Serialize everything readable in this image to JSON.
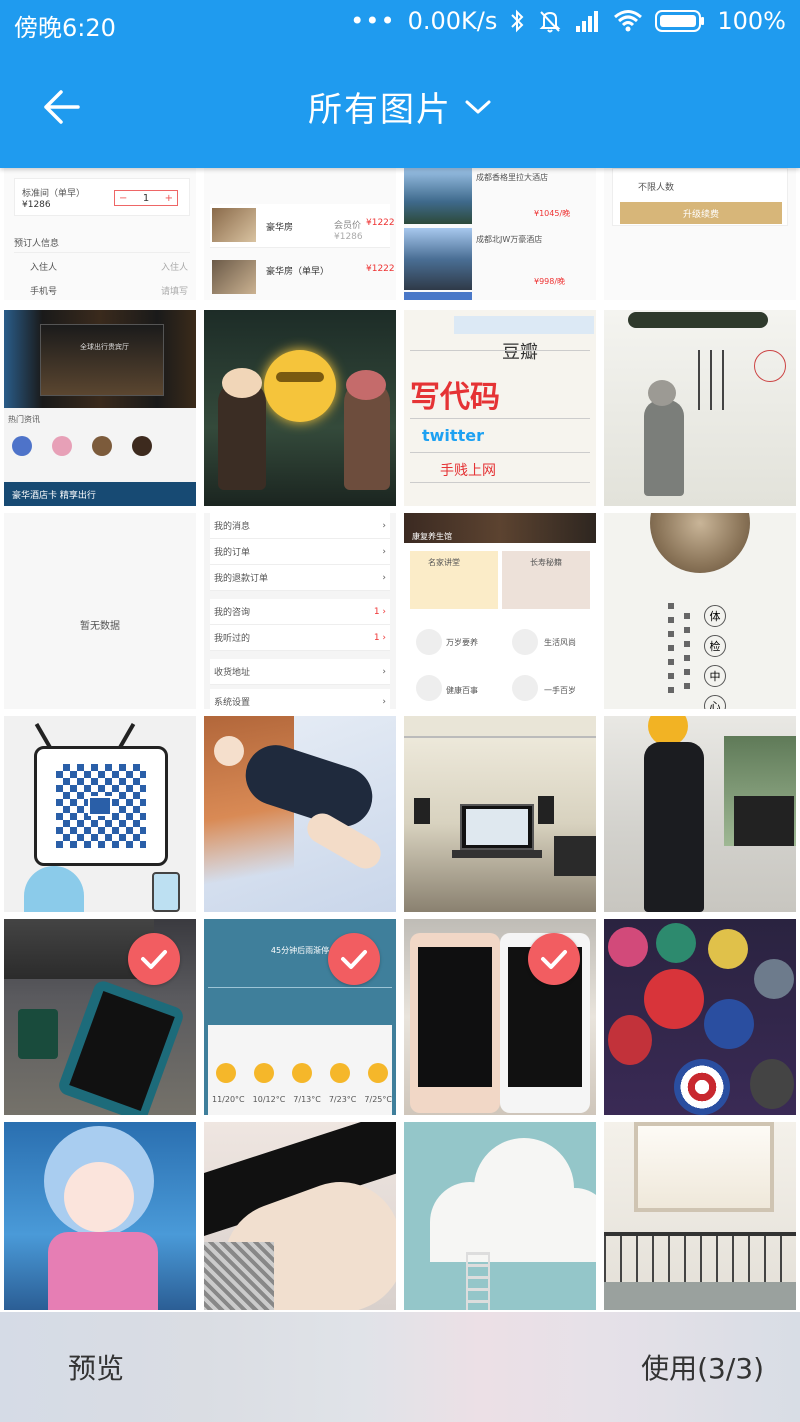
{
  "status_bar": {
    "time": "傍晚6:20",
    "dots": "•••",
    "speed": "0.00K/s",
    "battery": "100%"
  },
  "toolbar": {
    "title": "所有图片"
  },
  "grid": {
    "selected": [
      16,
      17,
      18
    ],
    "tiles": [
      {
        "id": 0,
        "kind": "screenshot-hotel-booking",
        "text": [
          "标准间（单早）",
          "¥1286",
          "预订人信息",
          "入住人",
          "入住人",
          "手机号",
          "请填写"
        ]
      },
      {
        "id": 1,
        "kind": "screenshot-hotel-list",
        "text": [
          "豪华房",
          "会员价",
          "¥1222",
          "¥1286",
          "豪华房（单早）",
          "¥1222"
        ]
      },
      {
        "id": 2,
        "kind": "screenshot-hotel-rooms",
        "text": [
          "成都香格里拉大酒店",
          "¥1045/晚",
          "成都北JW万豪酒店",
          "¥998/晚"
        ]
      },
      {
        "id": 3,
        "kind": "screenshot-form",
        "text": [
          "不限人数",
          "升级续费"
        ]
      },
      {
        "id": 4,
        "kind": "screenshot-hotel-home",
        "text": [
          "热门资讯",
          "全球出行贵宾厅",
          "豪华酒店卡 精享出行"
        ]
      },
      {
        "id": 5,
        "kind": "anime-forest"
      },
      {
        "id": 6,
        "kind": "poster-text",
        "text": [
          "写代码",
          "twitter",
          "豆瓣",
          "手贱上网"
        ]
      },
      {
        "id": 7,
        "kind": "ink-painting"
      },
      {
        "id": 8,
        "kind": "empty-state",
        "text": [
          "暂无数据"
        ]
      },
      {
        "id": 9,
        "kind": "screenshot-menu",
        "text": [
          "我的消息",
          "我的订单",
          "我的退款订单",
          "我的咨询",
          "我听过的",
          "收货地址",
          "系统设置"
        ]
      },
      {
        "id": 10,
        "kind": "screenshot-health",
        "text": [
          "康复养生馆",
          "名家讲堂",
          "长寿秘籍",
          "万岁要养",
          "生活风尚",
          "健康百事",
          "一手百岁"
        ]
      },
      {
        "id": 11,
        "kind": "ink-circle",
        "text": [
          "体",
          "检",
          "中",
          "心"
        ]
      },
      {
        "id": 12,
        "kind": "qr-tv"
      },
      {
        "id": 13,
        "kind": "anime-girl-lying"
      },
      {
        "id": 14,
        "kind": "office-laptop"
      },
      {
        "id": 15,
        "kind": "person-lobby"
      },
      {
        "id": 16,
        "kind": "phone-teal-desk"
      },
      {
        "id": 17,
        "kind": "screenshot-weather",
        "text": [
          "45分钟后雨渐停",
          "11/20°C",
          "10/12°C",
          "7/13°C",
          "7/23°C",
          "7/25°C"
        ]
      },
      {
        "id": 18,
        "kind": "two-phones"
      },
      {
        "id": 19,
        "kind": "superhero-poster"
      },
      {
        "id": 20,
        "kind": "anime-blue-hair"
      },
      {
        "id": 21,
        "kind": "legs-stockings"
      },
      {
        "id": 22,
        "kind": "cloud-ladder"
      },
      {
        "id": 23,
        "kind": "stairs-window"
      }
    ]
  },
  "bottom_bar": {
    "preview_label": "预览",
    "use_label": "使用(3/3)"
  },
  "colors": {
    "primary": "#1f9bef",
    "check": "#f25d61"
  },
  "icons": {
    "back": "arrow-left-icon",
    "dropdown": "chevron-down-icon",
    "check": "check-icon",
    "bluetooth": "bluetooth-icon",
    "mute": "bell-off-icon",
    "signal": "signal-icon",
    "wifi": "wifi-icon",
    "battery": "battery-icon"
  }
}
